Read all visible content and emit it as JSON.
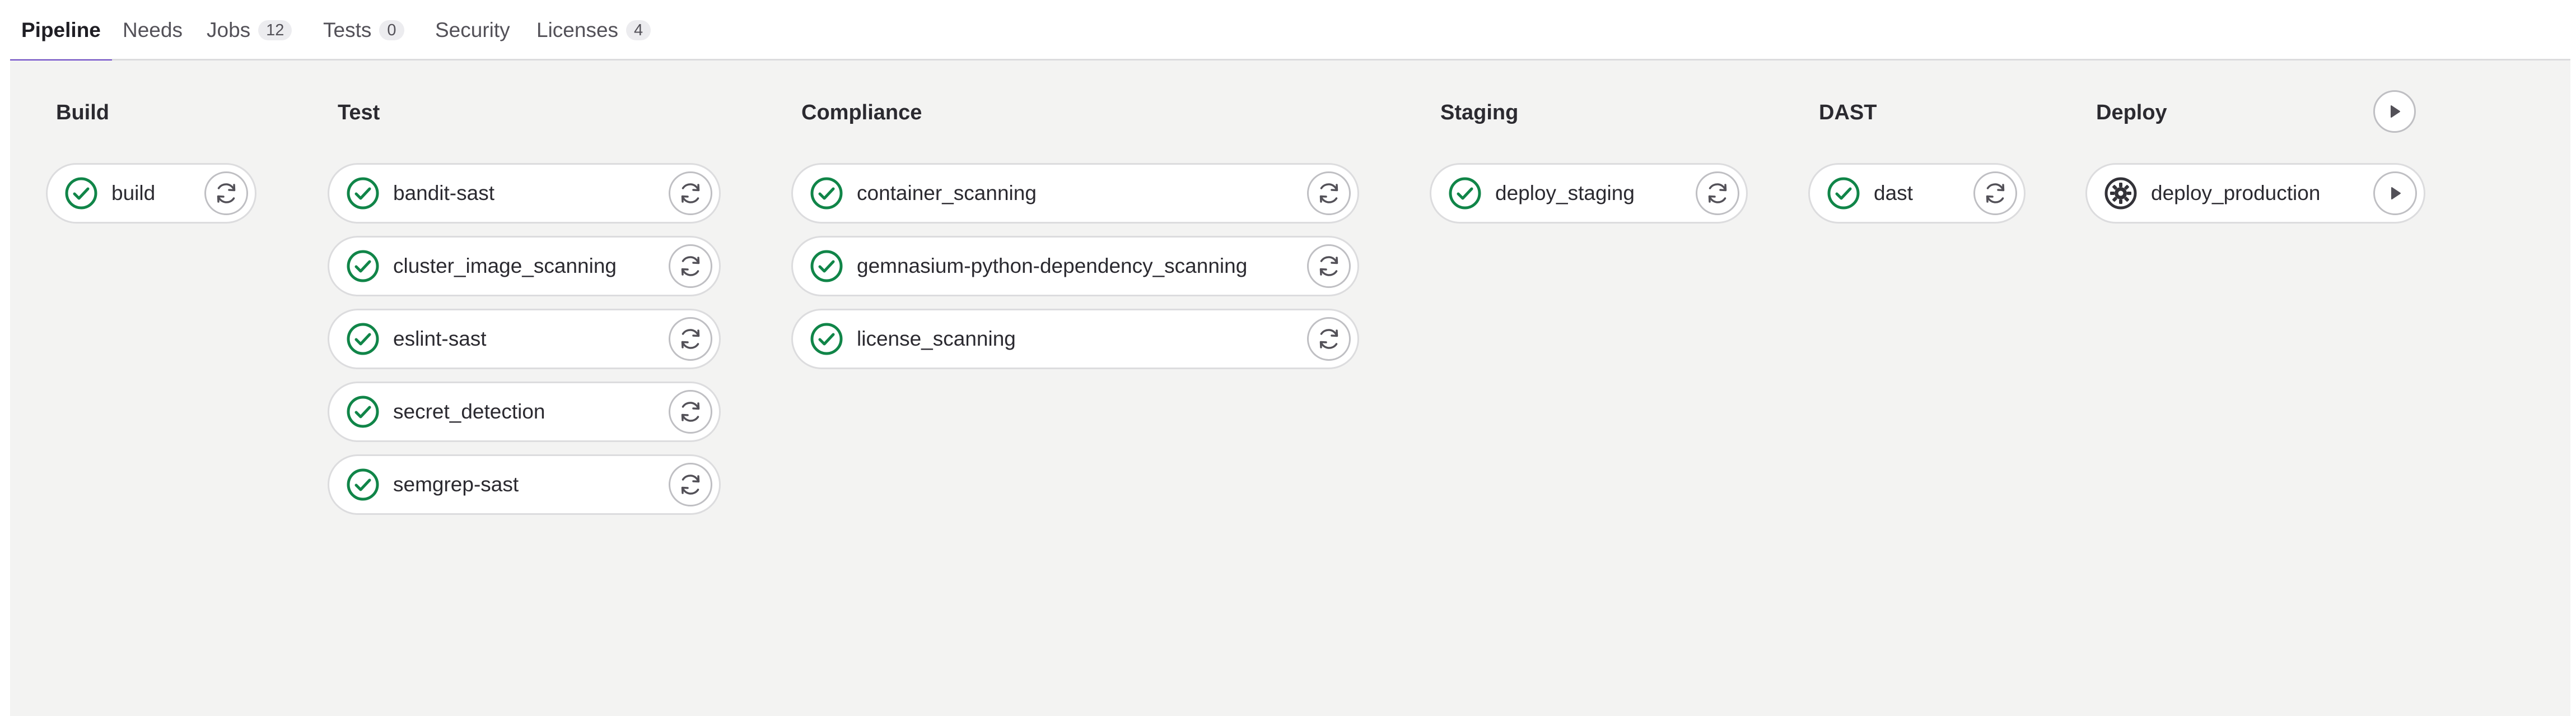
{
  "tabs": [
    {
      "label": "Pipeline",
      "count": null,
      "active": true
    },
    {
      "label": "Needs",
      "count": null,
      "active": false
    },
    {
      "label": "Jobs",
      "count": "12",
      "active": false
    },
    {
      "label": "Tests",
      "count": "0",
      "active": false
    },
    {
      "label": "Security",
      "count": null,
      "active": false
    },
    {
      "label": "Licenses",
      "count": "4",
      "active": false
    }
  ],
  "stages": [
    {
      "title": "Build",
      "action_icon": null,
      "jobs": [
        {
          "name": "build",
          "status": "success",
          "status_icon": "check-circle-icon",
          "action_icon": "retry-icon"
        }
      ]
    },
    {
      "title": "Test",
      "action_icon": null,
      "jobs": [
        {
          "name": "bandit-sast",
          "status": "success",
          "status_icon": "check-circle-icon",
          "action_icon": "retry-icon"
        },
        {
          "name": "cluster_image_scanning",
          "status": "success",
          "status_icon": "check-circle-icon",
          "action_icon": "retry-icon"
        },
        {
          "name": "eslint-sast",
          "status": "success",
          "status_icon": "check-circle-icon",
          "action_icon": "retry-icon"
        },
        {
          "name": "secret_detection",
          "status": "success",
          "status_icon": "check-circle-icon",
          "action_icon": "retry-icon"
        },
        {
          "name": "semgrep-sast",
          "status": "success",
          "status_icon": "check-circle-icon",
          "action_icon": "retry-icon"
        }
      ]
    },
    {
      "title": "Compliance",
      "action_icon": null,
      "jobs": [
        {
          "name": "container_scanning",
          "status": "success",
          "status_icon": "check-circle-icon",
          "action_icon": "retry-icon"
        },
        {
          "name": "gemnasium-python-dependency_scanning",
          "status": "success",
          "status_icon": "check-circle-icon",
          "action_icon": "retry-icon"
        },
        {
          "name": "license_scanning",
          "status": "success",
          "status_icon": "check-circle-icon",
          "action_icon": "retry-icon"
        }
      ]
    },
    {
      "title": "Staging",
      "action_icon": null,
      "jobs": [
        {
          "name": "deploy_staging",
          "status": "success",
          "status_icon": "check-circle-icon",
          "action_icon": "retry-icon"
        }
      ]
    },
    {
      "title": "DAST",
      "action_icon": null,
      "jobs": [
        {
          "name": "dast",
          "status": "success",
          "status_icon": "check-circle-icon",
          "action_icon": "retry-icon"
        }
      ]
    },
    {
      "title": "Deploy",
      "action_icon": "play-icon",
      "jobs": [
        {
          "name": "deploy_production",
          "status": "manual",
          "status_icon": "gear-icon",
          "action_icon": "play-icon"
        }
      ]
    }
  ],
  "colors": {
    "success": "#108548",
    "manual": "#333238",
    "accent": "#6e49cb",
    "graph_background": "#f3f3f2"
  }
}
